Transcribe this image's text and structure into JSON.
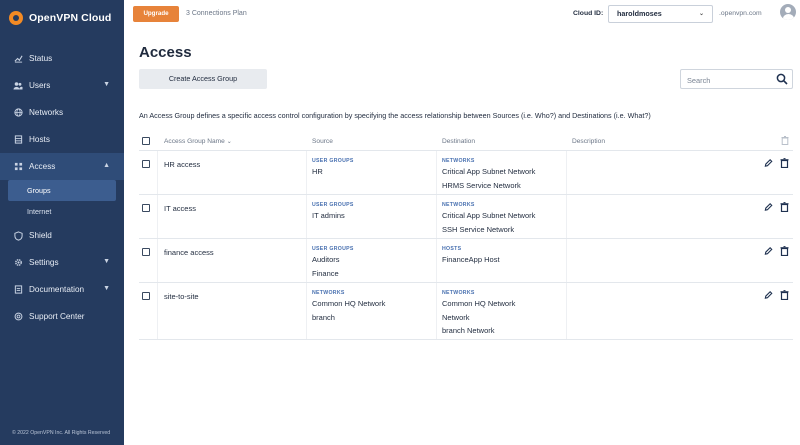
{
  "brand": {
    "name": "OpenVPN Cloud"
  },
  "sidebar": {
    "items": [
      {
        "label": "Status",
        "icon": "chart-icon"
      },
      {
        "label": "Users",
        "icon": "users-icon",
        "expandable": true
      },
      {
        "label": "Networks",
        "icon": "globe-icon"
      },
      {
        "label": "Hosts",
        "icon": "server-icon"
      },
      {
        "label": "Access",
        "icon": "access-icon",
        "expandable": true,
        "expanded": true,
        "children": [
          {
            "label": "Groups",
            "selected": true
          },
          {
            "label": "Internet"
          }
        ]
      },
      {
        "label": "Shield",
        "icon": "shield-icon"
      },
      {
        "label": "Settings",
        "icon": "gear-icon",
        "expandable": true
      },
      {
        "label": "Documentation",
        "icon": "doc-icon",
        "expandable": true
      },
      {
        "label": "Support Center",
        "icon": "support-icon"
      }
    ],
    "copyright": "© 2022 OpenVPN Inc. All Rights Reserved"
  },
  "header": {
    "upgrade_label": "Upgrade",
    "plan_text": "3 Connections Plan",
    "cloud_id_label": "Cloud ID:",
    "cloud_id_value": "haroldmoses",
    "domain_suffix": ".openvpn.com"
  },
  "main": {
    "title": "Access",
    "create_label": "Create Access Group",
    "search_placeholder": "Search",
    "description": "An Access Group defines a specific access control configuration by specifying the access relationship between Sources (i.e. Who?) and Destinations (i.e. What?)"
  },
  "table": {
    "columns": {
      "name": "Access Group Name",
      "source": "Source",
      "destination": "Destination",
      "description": "Description"
    },
    "rows": [
      {
        "name": "HR access",
        "source": {
          "kind": "USER GROUPS",
          "items": [
            "HR"
          ]
        },
        "destination": {
          "kind": "NETWORKS",
          "items": [
            "Critical App Subnet Network",
            "HRMS Service Network"
          ]
        },
        "description": ""
      },
      {
        "name": "IT access",
        "source": {
          "kind": "USER GROUPS",
          "items": [
            "IT admins"
          ]
        },
        "destination": {
          "kind": "NETWORKS",
          "items": [
            "Critical App Subnet Network",
            "SSH Service Network"
          ]
        },
        "description": ""
      },
      {
        "name": "finance access",
        "source": {
          "kind": "USER GROUPS",
          "items": [
            "Auditors",
            "Finance"
          ]
        },
        "destination": {
          "kind": "HOSTS",
          "items": [
            "FinanceApp Host"
          ]
        },
        "description": ""
      },
      {
        "name": "site-to-site",
        "source": {
          "kind": "NETWORKS",
          "items": [
            "Common HQ Network",
            "branch"
          ]
        },
        "destination": {
          "kind": "NETWORKS",
          "items": [
            "Common HQ Network",
            "Network",
            "branch Network"
          ]
        },
        "description": ""
      }
    ]
  },
  "colors": {
    "sidebar_bg": "#253b5f",
    "accent_orange": "#e7833a",
    "label_blue": "#4870b0"
  }
}
